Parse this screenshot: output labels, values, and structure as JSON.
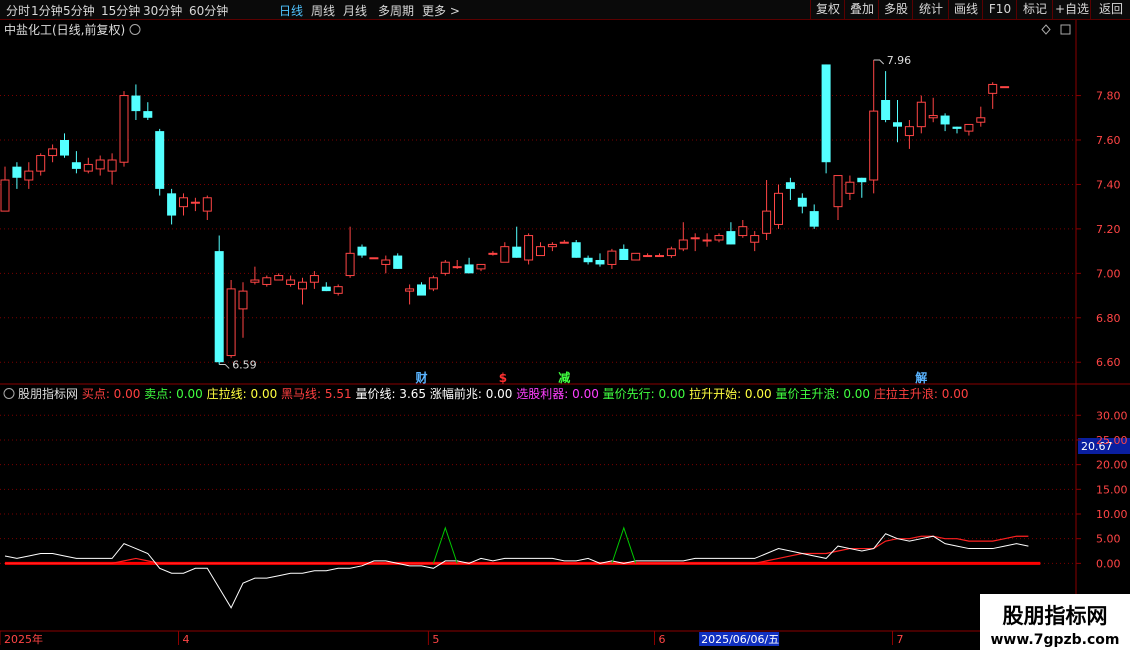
{
  "toolbar": {
    "timeframes": [
      "分时",
      "1分钟",
      "5分钟",
      "15分钟",
      "30分钟",
      "60分钟",
      "日线",
      "周线",
      "月线",
      "多周期",
      "更多 >"
    ],
    "active": "日线",
    "right_buttons": [
      "复权",
      "叠加",
      "多股",
      "统计",
      "画线",
      "F10",
      "标记",
      "+自选",
      "返回"
    ]
  },
  "price_panel": {
    "title": "中盐化工(日线,前复权)",
    "high_label": "7.96",
    "low_label": "6.59",
    "markers": [
      "财",
      "$",
      "减",
      "解"
    ]
  },
  "indicator_panel": {
    "name": "股朋指标网",
    "stats": [
      {
        "label": "买点:",
        "value": "0.00",
        "color": "#ff4040"
      },
      {
        "label": "卖点:",
        "value": "0.00",
        "color": "#40ff40"
      },
      {
        "label": "庄拉线:",
        "value": "0.00",
        "color": "#ffff40"
      },
      {
        "label": "黑马线:",
        "value": "5.51",
        "color": "#ff4040"
      },
      {
        "label": "量价线:",
        "value": "3.65",
        "color": "#ffffff"
      },
      {
        "label": "涨幅前兆:",
        "value": "0.00",
        "color": "#ffffff"
      },
      {
        "label": "选股利器:",
        "value": "0.00",
        "color": "#ff40ff"
      },
      {
        "label": "量价先行:",
        "value": "0.00",
        "color": "#40ff40"
      },
      {
        "label": "拉升开始:",
        "value": "0.00",
        "color": "#ffff40"
      },
      {
        "label": "量价主升浪:",
        "value": "0.00",
        "color": "#40ff40"
      },
      {
        "label": "庄拉主升浪:",
        "value": "0.00",
        "color": "#ff4040"
      }
    ],
    "current_value": "20.67"
  },
  "x_axis": {
    "labels": [
      {
        "text": "2025年",
        "index": 0
      },
      {
        "text": "4",
        "index": 15
      },
      {
        "text": "5",
        "index": 36
      },
      {
        "text": "6",
        "index": 55
      },
      {
        "text": "7",
        "index": 75
      }
    ],
    "highlight": {
      "text": "2025/06/06/五",
      "index": 59
    }
  },
  "watermark": {
    "line1": "股朋指标网",
    "line2": "www.7gpzb.com"
  },
  "chart_data": [
    {
      "type": "candlestick",
      "title": "中盐化工(日线,前复权)",
      "ylim": [
        6.52,
        8.05
      ],
      "yticks": [
        6.6,
        6.8,
        7.0,
        7.2,
        7.4,
        7.6,
        7.8
      ],
      "grid": true,
      "colors": {
        "up": "#ff4545",
        "down": "#54ffff",
        "grid": "#7a0000"
      },
      "ohlc": [
        [
          7.28,
          7.48,
          7.28,
          7.42
        ],
        [
          7.48,
          7.5,
          7.38,
          7.43
        ],
        [
          7.42,
          7.5,
          7.38,
          7.46
        ],
        [
          7.46,
          7.54,
          7.44,
          7.53
        ],
        [
          7.53,
          7.58,
          7.5,
          7.56
        ],
        [
          7.6,
          7.63,
          7.52,
          7.53
        ],
        [
          7.5,
          7.55,
          7.45,
          7.47
        ],
        [
          7.46,
          7.52,
          7.45,
          7.49
        ],
        [
          7.47,
          7.53,
          7.44,
          7.51
        ],
        [
          7.46,
          7.54,
          7.4,
          7.51
        ],
        [
          7.5,
          7.82,
          7.48,
          7.8
        ],
        [
          7.8,
          7.85,
          7.69,
          7.73
        ],
        [
          7.73,
          7.77,
          7.69,
          7.7
        ],
        [
          7.64,
          7.65,
          7.35,
          7.38
        ],
        [
          7.36,
          7.38,
          7.22,
          7.26
        ],
        [
          7.3,
          7.36,
          7.26,
          7.34
        ],
        [
          7.32,
          7.34,
          7.28,
          7.32
        ],
        [
          7.28,
          7.35,
          7.24,
          7.34
        ],
        [
          7.1,
          7.17,
          6.59,
          6.6
        ],
        [
          6.63,
          6.97,
          6.62,
          6.93
        ],
        [
          6.84,
          6.96,
          6.71,
          6.92
        ],
        [
          6.96,
          7.03,
          6.95,
          6.97
        ],
        [
          6.95,
          6.99,
          6.94,
          6.98
        ],
        [
          6.97,
          7.0,
          6.97,
          6.99
        ],
        [
          6.95,
          6.99,
          6.94,
          6.97
        ],
        [
          6.93,
          6.98,
          6.86,
          6.96
        ],
        [
          6.96,
          7.01,
          6.93,
          6.99
        ],
        [
          6.94,
          6.96,
          6.92,
          6.92
        ],
        [
          6.91,
          6.95,
          6.9,
          6.94
        ],
        [
          6.99,
          7.21,
          6.98,
          7.09
        ],
        [
          7.12,
          7.13,
          7.07,
          7.08
        ],
        [
          7.07,
          7.06,
          7.06,
          7.07
        ],
        [
          7.04,
          7.08,
          7.0,
          7.06
        ],
        [
          7.08,
          7.09,
          7.02,
          7.02
        ],
        [
          6.92,
          6.95,
          6.86,
          6.93
        ],
        [
          6.95,
          6.96,
          6.9,
          6.9
        ],
        [
          6.93,
          6.99,
          6.92,
          6.98
        ],
        [
          7.0,
          7.06,
          6.99,
          7.05
        ],
        [
          7.03,
          7.06,
          7.02,
          7.03
        ],
        [
          7.04,
          7.07,
          7.0,
          7.0
        ],
        [
          7.02,
          7.04,
          7.01,
          7.04
        ],
        [
          7.09,
          7.1,
          7.08,
          7.09
        ],
        [
          7.05,
          7.14,
          7.05,
          7.12
        ],
        [
          7.12,
          7.21,
          7.07,
          7.07
        ],
        [
          7.06,
          7.18,
          7.04,
          7.17
        ],
        [
          7.08,
          7.14,
          7.08,
          7.12
        ],
        [
          7.12,
          7.14,
          7.1,
          7.13
        ],
        [
          7.14,
          7.15,
          7.14,
          7.14
        ],
        [
          7.14,
          7.15,
          7.07,
          7.07
        ],
        [
          7.07,
          7.08,
          7.04,
          7.05
        ],
        [
          7.06,
          7.09,
          7.03,
          7.04
        ],
        [
          7.04,
          7.11,
          7.02,
          7.1
        ],
        [
          7.11,
          7.13,
          7.06,
          7.06
        ],
        [
          7.06,
          7.09,
          7.06,
          7.09
        ],
        [
          7.08,
          7.09,
          7.08,
          7.08
        ],
        [
          7.08,
          7.09,
          7.08,
          7.08
        ],
        [
          7.08,
          7.12,
          7.07,
          7.11
        ],
        [
          7.11,
          7.23,
          7.1,
          7.15
        ],
        [
          7.16,
          7.18,
          7.1,
          7.16
        ],
        [
          7.15,
          7.18,
          7.12,
          7.15
        ],
        [
          7.15,
          7.18,
          7.14,
          7.17
        ],
        [
          7.19,
          7.23,
          7.13,
          7.13
        ],
        [
          7.17,
          7.24,
          7.16,
          7.21
        ],
        [
          7.14,
          7.19,
          7.1,
          7.17
        ],
        [
          7.18,
          7.42,
          7.15,
          7.28
        ],
        [
          7.22,
          7.4,
          7.2,
          7.36
        ],
        [
          7.41,
          7.43,
          7.33,
          7.38
        ],
        [
          7.34,
          7.36,
          7.27,
          7.3
        ],
        [
          7.28,
          7.31,
          7.2,
          7.21
        ],
        [
          7.94,
          7.94,
          7.45,
          7.5
        ],
        [
          7.3,
          7.44,
          7.24,
          7.44
        ],
        [
          7.36,
          7.44,
          7.33,
          7.41
        ],
        [
          7.43,
          7.43,
          7.34,
          7.41
        ],
        [
          7.42,
          7.96,
          7.36,
          7.73
        ],
        [
          7.78,
          7.91,
          7.68,
          7.69
        ],
        [
          7.68,
          7.78,
          7.59,
          7.66
        ],
        [
          7.62,
          7.69,
          7.56,
          7.66
        ],
        [
          7.66,
          7.8,
          7.63,
          7.77
        ],
        [
          7.7,
          7.79,
          7.68,
          7.71
        ],
        [
          7.71,
          7.72,
          7.64,
          7.67
        ],
        [
          7.66,
          7.66,
          7.63,
          7.65
        ],
        [
          7.64,
          7.67,
          7.62,
          7.67
        ],
        [
          7.68,
          7.75,
          7.66,
          7.7
        ],
        [
          7.81,
          7.86,
          7.74,
          7.85
        ],
        [
          7.84,
          7.84,
          7.84,
          7.84
        ]
      ]
    },
    {
      "type": "line",
      "title": "股朋指标网",
      "ylim": [
        -13.5,
        33.5
      ],
      "yticks": [
        0,
        5,
        10,
        15,
        20,
        25,
        30
      ],
      "grid": true,
      "series": [
        {
          "name": "量价线",
          "color": "#ffffff",
          "values": [
            1.5,
            1,
            1.5,
            2,
            2,
            1.5,
            1,
            1,
            1,
            1,
            4,
            3,
            2,
            -1,
            -2,
            -2,
            -1,
            -1,
            -5,
            -9,
            -4,
            -3,
            -3,
            -2.5,
            -2,
            -2,
            -1.5,
            -1.5,
            -1,
            -1,
            -0.5,
            0.5,
            0.5,
            0,
            -0.5,
            -0.5,
            -1,
            0.5,
            0.5,
            0,
            1,
            0.5,
            1,
            1,
            1,
            1,
            1,
            0.5,
            0.5,
            1,
            0,
            0.5,
            0,
            0.5,
            0.5,
            0.5,
            0.5,
            0.5,
            1,
            1,
            1,
            1,
            1,
            1,
            2,
            3,
            2.5,
            2,
            1.5,
            1,
            3.5,
            3,
            2.5,
            3,
            6,
            5,
            4.5,
            5,
            5.5,
            4,
            3.5,
            3,
            3,
            3,
            3.5,
            4,
            3.5
          ]
        },
        {
          "name": "黑马线",
          "color": "#ff2020",
          "values": [
            0,
            0,
            0,
            0,
            0,
            0,
            0,
            0,
            0,
            0,
            0.5,
            1,
            0.5,
            0,
            0,
            0,
            0,
            0,
            0,
            0,
            0,
            0,
            0,
            0,
            0,
            0,
            0,
            0,
            0,
            0,
            0,
            0,
            0,
            0,
            0,
            0,
            0,
            0,
            0,
            0,
            0,
            0,
            0,
            0,
            0,
            0,
            0,
            0,
            0,
            0,
            0,
            0,
            0,
            0,
            0,
            0,
            0,
            0,
            0,
            0,
            0,
            0,
            0,
            0,
            0.5,
            1,
            1.5,
            2,
            2,
            2,
            2.5,
            3,
            3,
            3,
            4.5,
            5,
            5,
            5.5,
            5.5,
            5,
            5,
            4.5,
            4.5,
            4.5,
            5,
            5.5,
            5.5
          ]
        },
        {
          "name": "buy_signal",
          "color": "#00c800",
          "spikes": [
            37,
            52
          ],
          "value": 7.2
        },
        {
          "name": "base",
          "color": "#ff0000",
          "value": 0
        }
      ]
    }
  ]
}
